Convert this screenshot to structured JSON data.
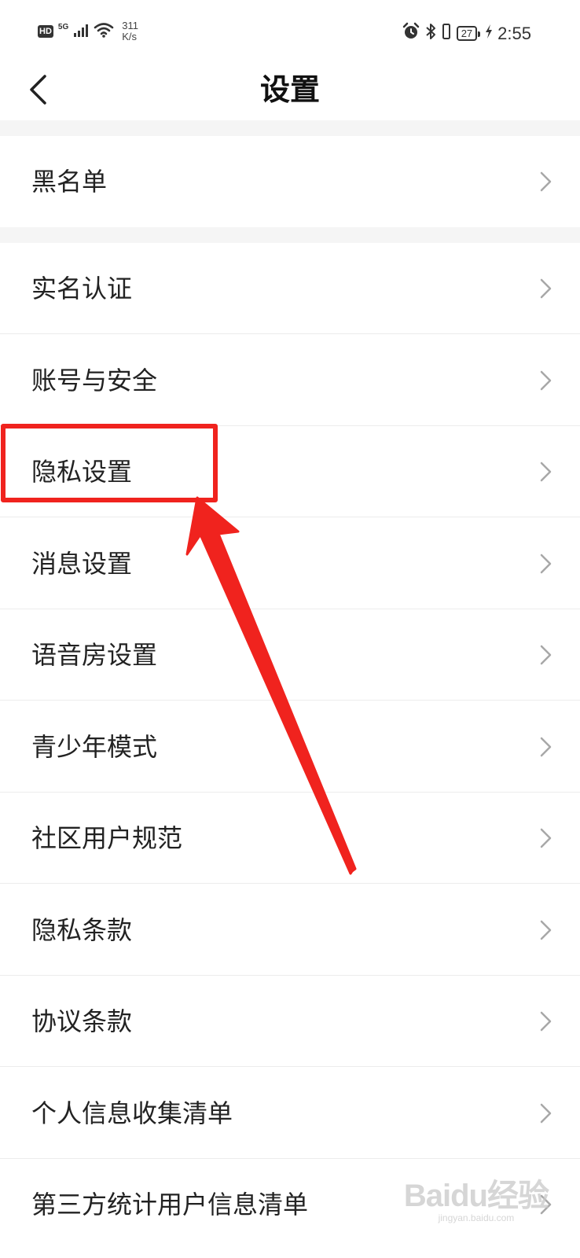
{
  "status_bar": {
    "hd": "HD",
    "network": "5G",
    "speed_value": "311",
    "speed_unit": "K/s",
    "battery": "27",
    "time": "2:55"
  },
  "header": {
    "title": "设置"
  },
  "items": [
    {
      "label": "黑名单"
    },
    {
      "label": "实名认证"
    },
    {
      "label": "账号与安全"
    },
    {
      "label": "隐私设置"
    },
    {
      "label": "消息设置"
    },
    {
      "label": "语音房设置"
    },
    {
      "label": "青少年模式"
    },
    {
      "label": "社区用户规范"
    },
    {
      "label": "隐私条款"
    },
    {
      "label": "协议条款"
    },
    {
      "label": "个人信息收集清单"
    },
    {
      "label": "第三方统计用户信息清单"
    }
  ],
  "watermark": {
    "logo": "Baidu经验",
    "url": "jingyan.baidu.com"
  },
  "colors": {
    "annotation_red": "#f0231e",
    "divider_gray": "#f5f5f5"
  }
}
